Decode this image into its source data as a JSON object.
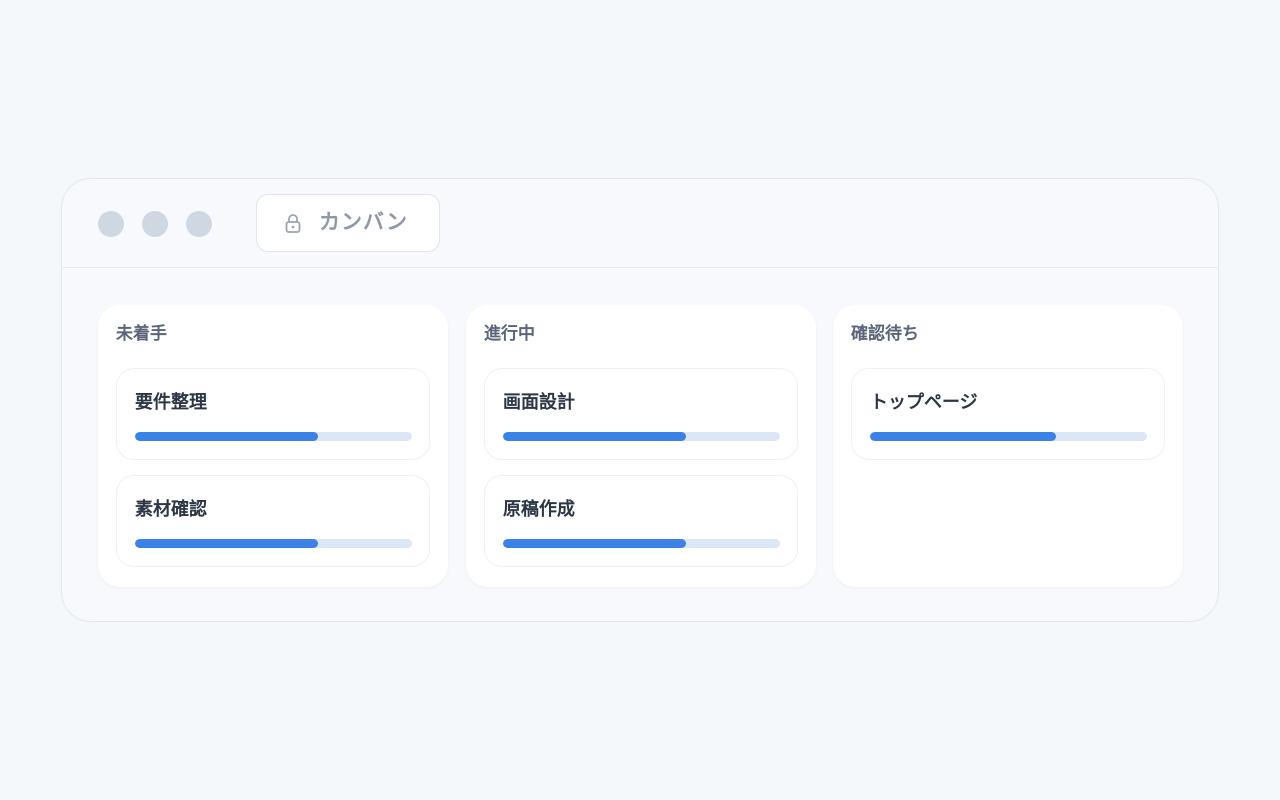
{
  "window": {
    "address_text": "カンバン",
    "address_icon": "lock-icon"
  },
  "columns": [
    {
      "title": "未着手",
      "cards": [
        {
          "title": "要件整理",
          "progress": 0.66
        },
        {
          "title": "素材確認",
          "progress": 0.66
        }
      ]
    },
    {
      "title": "進行中",
      "cards": [
        {
          "title": "画面設計",
          "progress": 0.66
        },
        {
          "title": "原稿作成",
          "progress": 0.66
        }
      ]
    },
    {
      "title": "確認待ち",
      "cards": [
        {
          "title": "トップページ",
          "progress": 0.67
        }
      ]
    }
  ],
  "colors": {
    "accent": "#3b82e6",
    "track": "#dbe7f7",
    "background": "#f5f8fb"
  }
}
